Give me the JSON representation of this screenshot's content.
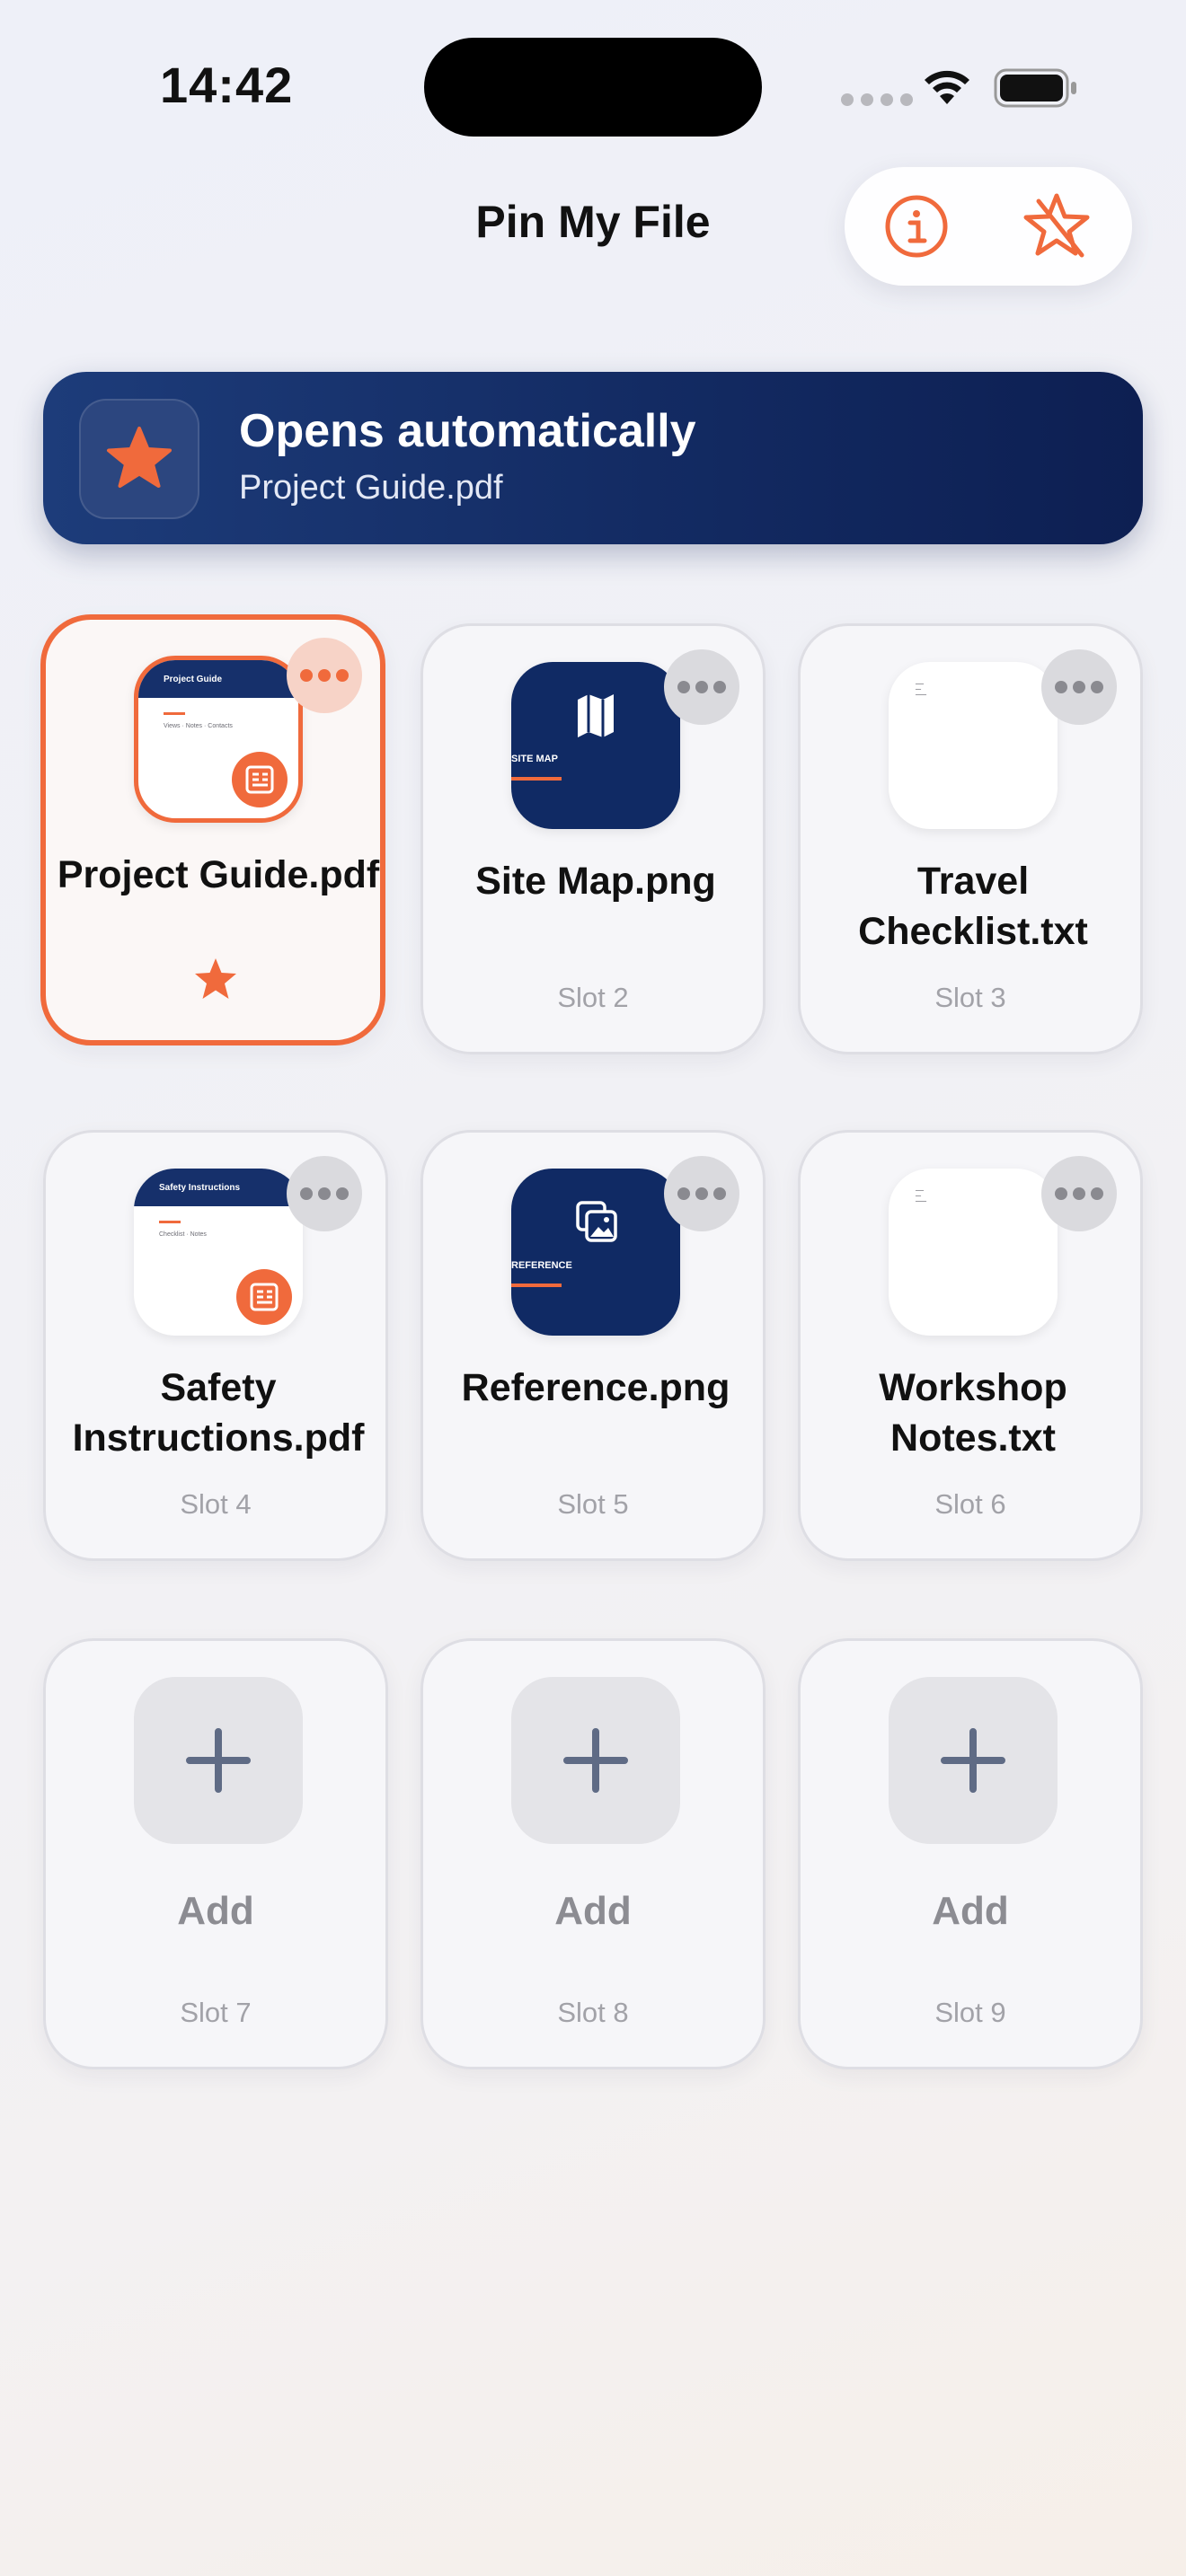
{
  "status_bar": {
    "time": "14:42"
  },
  "header": {
    "title": "Pin My File",
    "info_icon": "info-circle-icon",
    "favorites_icon": "star-slash-icon"
  },
  "banner": {
    "title": "Opens automatically",
    "file": "Project Guide.pdf",
    "icon": "star-icon"
  },
  "colors": {
    "accent": "#F06A3C",
    "navy": "#132B63"
  },
  "slots": [
    {
      "name": "Project Guide.pdf",
      "slot": "",
      "type": "pdf",
      "selected": true,
      "doc_title": "Project Guide",
      "doc_line": "Views · Notes · Contacts"
    },
    {
      "name": "Site Map.png",
      "slot": "Slot 2",
      "type": "image",
      "caption": "SITE MAP"
    },
    {
      "name": "Travel Checklist.txt",
      "slot": "Slot 3",
      "type": "text"
    },
    {
      "name": "Safety Instructions.pdf",
      "slot": "Slot 4",
      "type": "pdf",
      "doc_title": "Safety Instructions",
      "doc_line": "Checklist · Notes"
    },
    {
      "name": "Reference.png",
      "slot": "Slot 5",
      "type": "image",
      "caption": "REFERENCE"
    },
    {
      "name": "Workshop Notes.txt",
      "slot": "Slot 6",
      "type": "text"
    },
    {
      "name": "Add",
      "slot": "Slot 7",
      "type": "empty"
    },
    {
      "name": "Add",
      "slot": "Slot 8",
      "type": "empty"
    },
    {
      "name": "Add",
      "slot": "Slot 9",
      "type": "empty"
    }
  ]
}
